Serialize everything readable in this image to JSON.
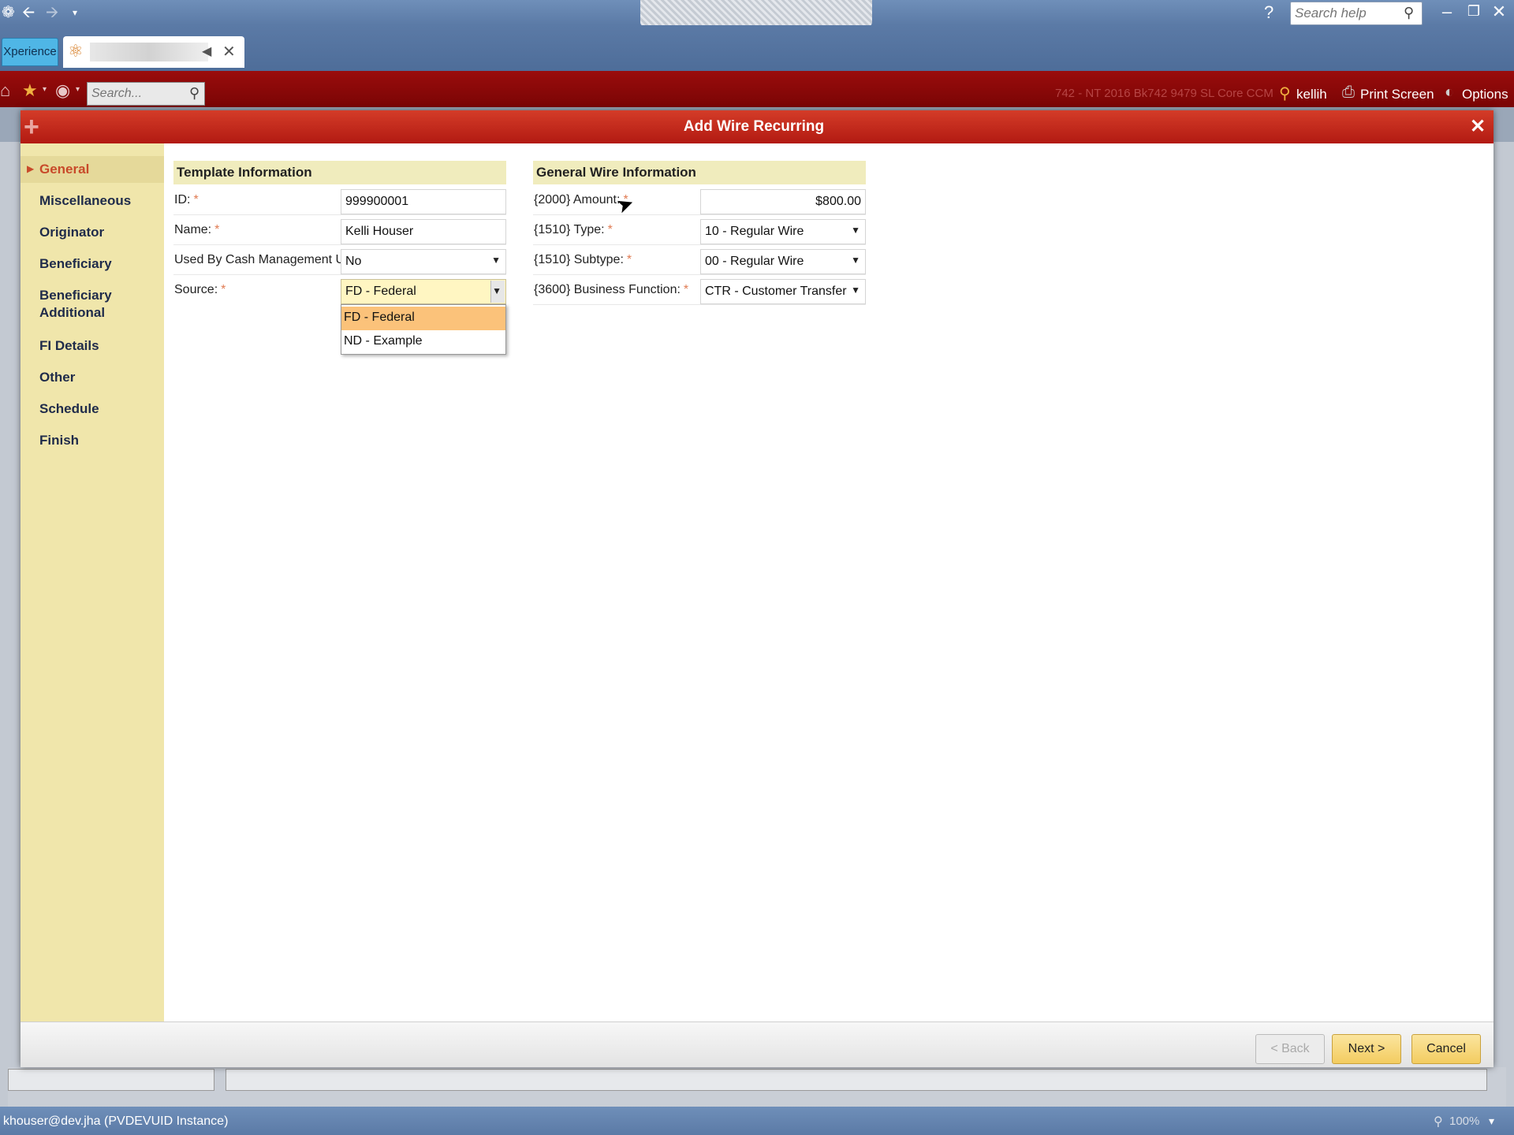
{
  "window": {
    "help_search_placeholder": "Search help"
  },
  "tabs": {
    "xperience": "Xperience"
  },
  "toolbar": {
    "search_placeholder": "Search...",
    "faded_info": "742 - NT 2016 Bk742 9479 SL Core CCM",
    "user": "kellih",
    "print_screen": "Print Screen",
    "options": "Options"
  },
  "modal": {
    "title": "Add Wire Recurring",
    "nav": [
      "General",
      "Miscellaneous",
      "Originator",
      "Beneficiary",
      "Beneficiary Additional",
      "FI Details",
      "Other",
      "Schedule",
      "Finish"
    ],
    "active_nav": "General"
  },
  "template_info": {
    "header": "Template Information",
    "id_label": "ID:",
    "id_value": "999900001",
    "name_label": "Name:",
    "name_value": "Kelli Houser",
    "cash_label": "Used By Cash Management User:",
    "cash_value": "No",
    "source_label": "Source:",
    "source_value": "FD - Federal",
    "source_options": [
      "FD - Federal",
      "ND - Example"
    ]
  },
  "wire_info": {
    "header": "General Wire Information",
    "amount_label": "{2000} Amount:",
    "amount_value": "$800.00",
    "type_label": "{1510} Type:",
    "type_value": "10 - Regular Wire",
    "subtype_label": "{1510} Subtype:",
    "subtype_value": "00 - Regular Wire",
    "bf_label": "{3600} Business Function:",
    "bf_value": "CTR - Customer Transfer"
  },
  "footer": {
    "back": "< Back",
    "next": "Next >",
    "cancel": "Cancel"
  },
  "status": {
    "text": "khouser@dev.jha (PVDEVUID Instance)",
    "zoom": "100%"
  }
}
